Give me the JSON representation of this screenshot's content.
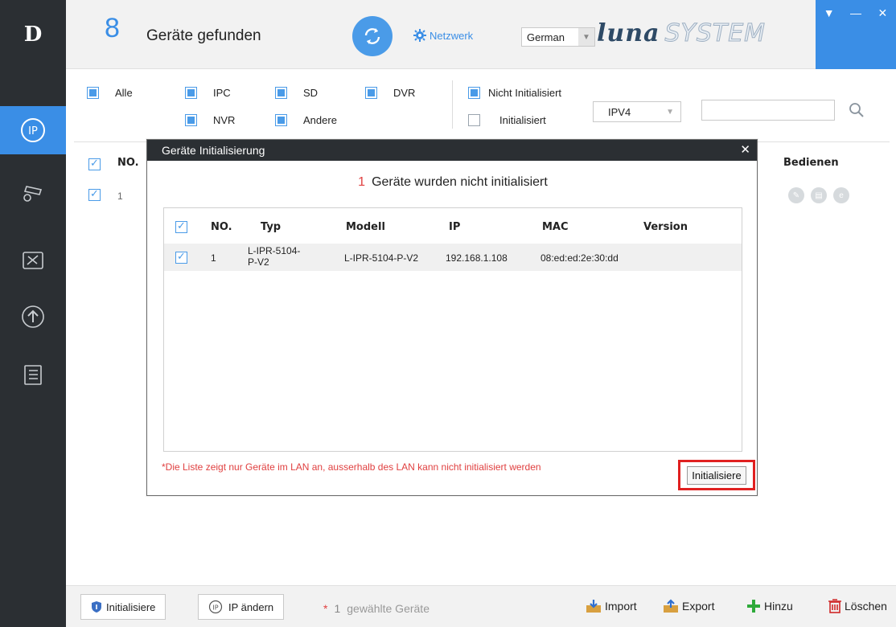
{
  "header": {
    "device_count": "8",
    "found_label": "Geräte gefunden",
    "network_label": "Netzwerk",
    "language": "German",
    "brand_luna": "luna",
    "brand_system": "SYSTEM"
  },
  "filters": {
    "all": "Alle",
    "ipc": "IPC",
    "sd": "SD",
    "dvr": "DVR",
    "nvr": "NVR",
    "other": "Andere",
    "not_initialized": "Nicht Initialisiert",
    "initialized": "Initialisiert",
    "ip_version": "IPV4",
    "search_value": ""
  },
  "list": {
    "col_no": "NO.",
    "col_operate": "Bedienen",
    "rows": [
      {
        "no": "1"
      }
    ]
  },
  "modal": {
    "title": "Geräte Initialisierung",
    "subtitle_count": "1",
    "subtitle_text": "Geräte wurden nicht initialisiert",
    "columns": {
      "no": "NO.",
      "type": "Typ",
      "model": "Modell",
      "ip": "IP",
      "mac": "MAC",
      "version": "Version"
    },
    "rows": [
      {
        "no": "1",
        "type": "L-IPR-5104-P-V2",
        "model": "L-IPR-5104-P-V2",
        "ip": "192.168.1.108",
        "mac": "08:ed:ed:2e:30:dd",
        "version": ""
      }
    ],
    "note": "*Die Liste zeigt nur Geräte im LAN an, ausserhalb des LAN kann nicht initialisiert werden",
    "init_button": "Initialisiere"
  },
  "bottom": {
    "initialize": "Initialisiere",
    "change_ip": "IP ändern",
    "selected_star": "*",
    "selected_count": "1",
    "selected_label": "gewählte Geräte",
    "import": "Import",
    "export": "Export",
    "add": "Hinzu",
    "delete": "Löschen"
  },
  "colors": {
    "accent": "#3a8ee6",
    "sidebar": "#2b2f33",
    "warning": "#e04040",
    "highlight_border": "#e02020"
  }
}
